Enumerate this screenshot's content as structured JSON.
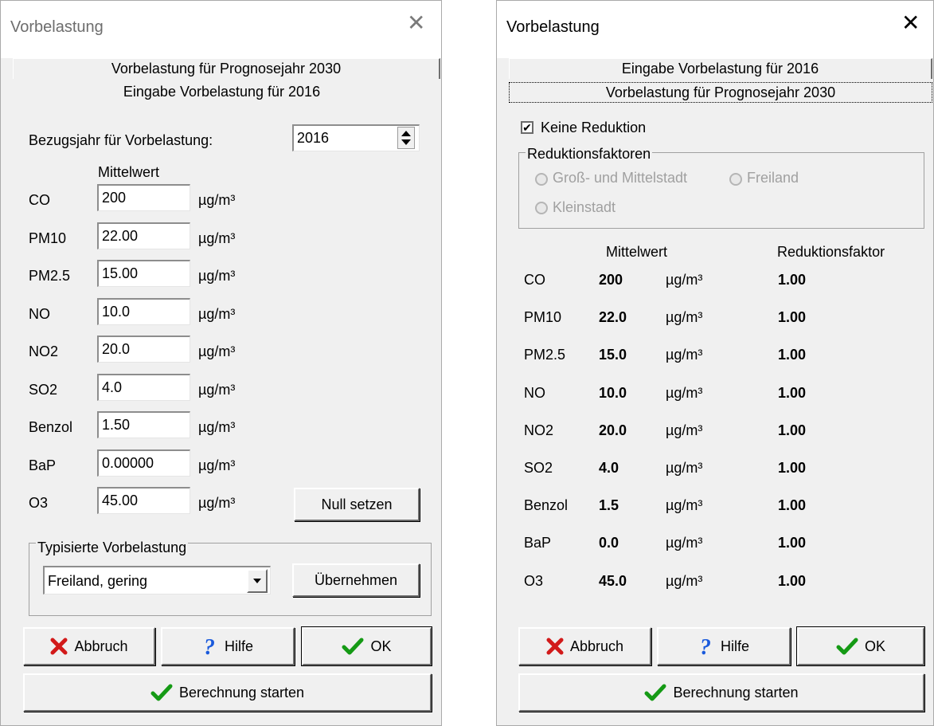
{
  "left": {
    "title": "Vorbelastung",
    "tabs": [
      "Vorbelastung für Prognosejahr 2030",
      "Eingabe Vorbelastung für 2016"
    ],
    "bezugsjahr_label": "Bezugsjahr für Vorbelastung:",
    "bezugsjahr_value": "2016",
    "mittelwert_header": "Mittelwert",
    "unit": "µg/m³",
    "rows": [
      {
        "label": "CO",
        "value": "200"
      },
      {
        "label": "PM10",
        "value": "22.00"
      },
      {
        "label": "PM2.5",
        "value": "15.00"
      },
      {
        "label": "NO",
        "value": "10.0"
      },
      {
        "label": "NO2",
        "value": "20.0"
      },
      {
        "label": "SO2",
        "value": "4.0"
      },
      {
        "label": "Benzol",
        "value": "1.50"
      },
      {
        "label": "BaP",
        "value": "0.00000"
      },
      {
        "label": "O3",
        "value": "45.00"
      }
    ],
    "null_setzen": "Null setzen",
    "typisiert_legend": "Typisierte Vorbelastung",
    "typisiert_selected": "Freiland, gering",
    "uebernehmen": "Übernehmen",
    "abbruch": "Abbruch",
    "hilfe": "Hilfe",
    "ok": "OK",
    "berechnung": "Berechnung starten"
  },
  "right": {
    "title": "Vorbelastung",
    "tabs": [
      "Eingabe Vorbelastung für 2016",
      "Vorbelastung für Prognosejahr 2030"
    ],
    "keine_reduktion": "Keine Reduktion",
    "keine_reduktion_checked": true,
    "reduktion_legend": "Reduktionsfaktoren",
    "radio_gross": "Groß- und Mittelstadt",
    "radio_freiland": "Freiland",
    "radio_klein": "Kleinstadt",
    "mittelwert_header": "Mittelwert",
    "reduktion_header": "Reduktionsfaktor",
    "unit": "µg/m³",
    "rows": [
      {
        "label": "CO",
        "value": "200",
        "factor": "1.00"
      },
      {
        "label": "PM10",
        "value": "22.0",
        "factor": "1.00"
      },
      {
        "label": "PM2.5",
        "value": "15.0",
        "factor": "1.00"
      },
      {
        "label": "NO",
        "value": "10.0",
        "factor": "1.00"
      },
      {
        "label": "NO2",
        "value": "20.0",
        "factor": "1.00"
      },
      {
        "label": "SO2",
        "value": "4.0",
        "factor": "1.00"
      },
      {
        "label": "Benzol",
        "value": "1.5",
        "factor": "1.00"
      },
      {
        "label": "BaP",
        "value": "0.0",
        "factor": "1.00"
      },
      {
        "label": "O3",
        "value": "45.0",
        "factor": "1.00"
      }
    ],
    "abbruch": "Abbruch",
    "hilfe": "Hilfe",
    "ok": "OK",
    "berechnung": "Berechnung starten"
  },
  "colors": {
    "window_bg": "#f0f0f0",
    "cancel_red": "#d21a1a",
    "ok_green": "#159a15",
    "help_blue": "#1a5adc",
    "disabled_text": "#a0a0a0"
  },
  "icons": {
    "cancel": "x-icon",
    "help": "question-icon",
    "ok": "checkmark-icon",
    "close": "close-icon"
  }
}
